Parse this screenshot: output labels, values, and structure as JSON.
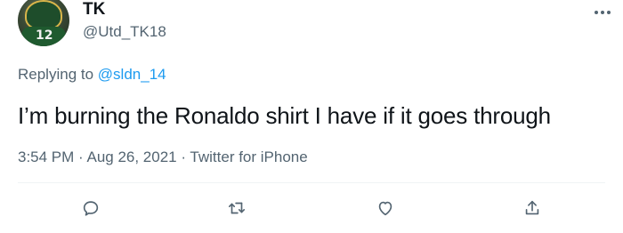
{
  "user": {
    "name": "TK",
    "handle": "@Utd_TK18"
  },
  "avatar": {
    "jersey_number": "12"
  },
  "reply": {
    "prefix": "Replying to",
    "mention": "@sldn_14"
  },
  "tweet": {
    "text": "I’m burning the Ronaldo shirt I have if it goes through"
  },
  "meta": {
    "text": "3:54 PM · Aug 26, 2021 · Twitter for iPhone"
  },
  "icons": {
    "more": "more-horizontal-icon",
    "reply": "reply-icon",
    "retweet": "retweet-icon",
    "like": "like-icon",
    "share": "share-icon"
  },
  "colors": {
    "link": "#1d9bf0",
    "muted": "#536471",
    "text": "#0f1419"
  }
}
